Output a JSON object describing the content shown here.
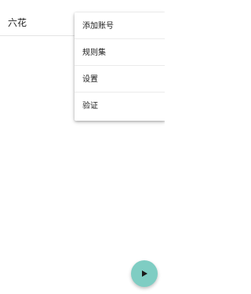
{
  "app_bar": {
    "title": "六花"
  },
  "overflow_menu": {
    "items": [
      {
        "label": "添加账号"
      },
      {
        "label": "规则集"
      },
      {
        "label": "设置"
      },
      {
        "label": "验证"
      }
    ]
  },
  "fab": {
    "icon": "play-icon",
    "color": "#7fcdc3"
  }
}
